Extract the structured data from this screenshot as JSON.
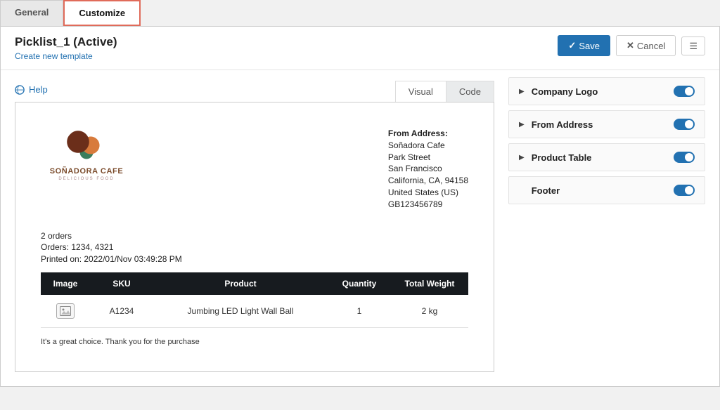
{
  "tabs": {
    "general": "General",
    "customize": "Customize"
  },
  "title": "Picklist_1 (Active)",
  "create_link": "Create new template",
  "buttons": {
    "save": "Save",
    "cancel": "Cancel"
  },
  "help": "Help",
  "view_tabs": {
    "visual": "Visual",
    "code": "Code"
  },
  "from": {
    "heading": "From Address:",
    "name": "Soñadora Cafe",
    "street": "Park Street",
    "city": "San Francisco",
    "region": "California, CA, 94158",
    "country": "United States (US)",
    "vat": "GB123456789"
  },
  "logo": {
    "name": "SOÑADORA CAFE",
    "sub": "DELICIOUS FOOD"
  },
  "meta": {
    "orders_count": "2 orders",
    "orders_list": "Orders: 1234, 4321",
    "printed_on": "Printed on: 2022/01/Nov 03:49:28 PM"
  },
  "table": {
    "headers": {
      "image": "Image",
      "sku": "SKU",
      "product": "Product",
      "qty": "Quantity",
      "weight": "Total Weight"
    },
    "rows": [
      {
        "sku": "A1234",
        "product": "Jumbing LED Light Wall Ball",
        "qty": "1",
        "weight": "2 kg"
      }
    ]
  },
  "footer": "It's a great choice. Thank you for the purchase",
  "options": {
    "company_logo": "Company Logo",
    "from_address": "From Address",
    "product_table": "Product Table",
    "footer": "Footer"
  }
}
